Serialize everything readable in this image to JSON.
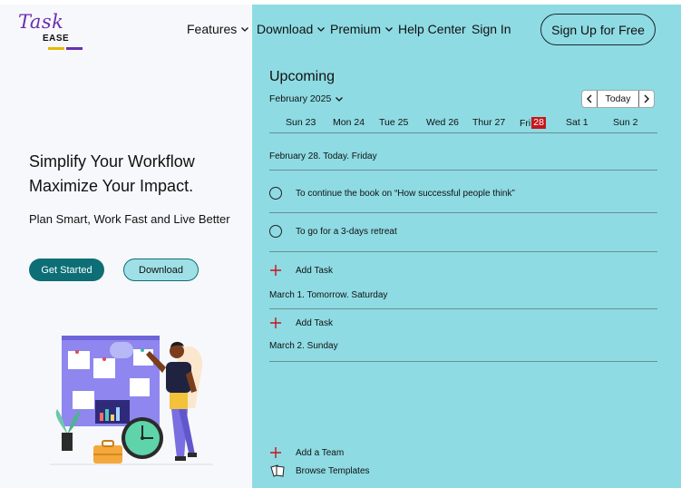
{
  "brand": {
    "script": "Task",
    "name": "EASE"
  },
  "nav": {
    "items": [
      {
        "label": "Features",
        "has_menu": true
      },
      {
        "label": "Download",
        "has_menu": true
      },
      {
        "label": "Premium",
        "has_menu": true
      },
      {
        "label": "Help Center",
        "has_menu": false
      },
      {
        "label": "Sign In",
        "has_menu": false
      }
    ],
    "signup_label": "Sign Up for Free"
  },
  "hero": {
    "title_line1": "Simplify Your Workflow",
    "title_line2": "Maximize Your Impact.",
    "subtitle": "Plan Smart, Work Fast and Live Better",
    "primary_label": "Get Started",
    "secondary_label": "Download"
  },
  "calendar": {
    "heading": "Upcoming",
    "month": "February 2025",
    "today_label": "Today",
    "days": [
      {
        "name": "Sun",
        "num": "23",
        "today": false
      },
      {
        "name": "Mon",
        "num": "24",
        "today": false
      },
      {
        "name": "Tue",
        "num": "25",
        "today": false
      },
      {
        "name": "Wed",
        "num": "26",
        "today": false
      },
      {
        "name": "Thur",
        "num": "27",
        "today": false
      },
      {
        "name": "Fri",
        "num": "28",
        "today": true
      },
      {
        "name": "Sat",
        "num": "1",
        "today": false
      },
      {
        "name": "Sun",
        "num": "2",
        "today": false
      }
    ],
    "sections": [
      {
        "label": "February 28. Today. Friday",
        "tasks": [
          "To continue the book on “How successful people think”",
          "To go for a 3-days retreat"
        ],
        "add_label": "Add Task"
      },
      {
        "label": "March 1. Tomorrow. Saturday",
        "add_label": "Add Task"
      },
      {
        "label": "March 2. Sunday"
      }
    ],
    "add_team_label": "Add a Team",
    "browse_label": "Browse Templates"
  },
  "colors": {
    "accent_teal": "#0d6e76",
    "panel_cyan": "#8edbe3",
    "today_red": "#c4161c",
    "brand_purple": "#6a2fb0",
    "brand_yellow": "#e6b800"
  }
}
